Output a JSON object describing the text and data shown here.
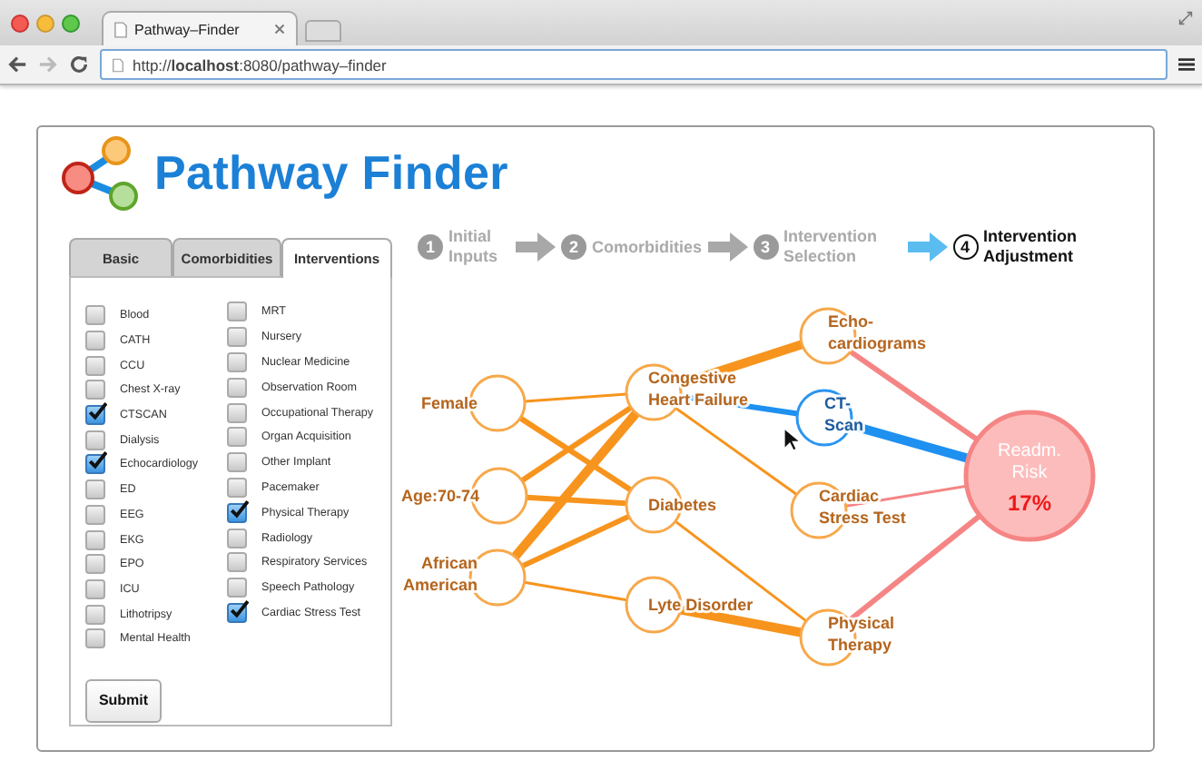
{
  "browser": {
    "tab_title": "Pathway–Finder",
    "url": "http://**localhost**:8080/pathway–finder"
  },
  "app": {
    "title": "Pathway Finder"
  },
  "tabs": [
    {
      "label": "Basic",
      "selected": false
    },
    {
      "label": "Comorbidities",
      "selected": false
    },
    {
      "label": "Interventions",
      "selected": true
    }
  ],
  "interventions": {
    "columns": [
      {
        "items": [
          {
            "label": "Blood",
            "checked": false
          },
          {
            "label": "CATH",
            "checked": false
          },
          {
            "label": "CCU",
            "checked": false
          },
          {
            "label": "Chest X-ray",
            "checked": false
          },
          {
            "label": "CTSCAN",
            "checked": true
          },
          {
            "label": "Dialysis",
            "checked": false
          },
          {
            "label": "Echocardiology",
            "checked": true
          },
          {
            "label": "ED",
            "checked": false
          },
          {
            "label": "EEG",
            "checked": false
          },
          {
            "label": "EKG",
            "checked": false
          },
          {
            "label": "EPO",
            "checked": false
          },
          {
            "label": "ICU",
            "checked": false
          },
          {
            "label": "Lithotripsy",
            "checked": false
          },
          {
            "label": "Mental Health",
            "checked": false
          }
        ]
      },
      {
        "items": [
          {
            "label": "MRT",
            "checked": false
          },
          {
            "label": "Nursery",
            "checked": false
          },
          {
            "label": "Nuclear Medicine",
            "checked": false
          },
          {
            "label": "Observation Room",
            "checked": false
          },
          {
            "label": "Occupational Therapy",
            "checked": false
          },
          {
            "label": "Organ Acquisition",
            "checked": false
          },
          {
            "label": "Other Implant",
            "checked": false
          },
          {
            "label": "Pacemaker",
            "checked": false
          },
          {
            "label": "Physical Therapy",
            "checked": true
          },
          {
            "label": "Radiology",
            "checked": false
          },
          {
            "label": "Respiratory Services",
            "checked": false
          },
          {
            "label": "Speech Pathology",
            "checked": false
          },
          {
            "label": "Cardiac Stress Test",
            "checked": true
          }
        ]
      }
    ]
  },
  "submit": "Submit",
  "steps": [
    {
      "number": "1",
      "label": "Initial Inputs",
      "selected": false
    },
    {
      "number": "2",
      "label": "Comorbidities",
      "selected": false
    },
    {
      "number": "3",
      "label": "Intervention Selection",
      "selected": false
    },
    {
      "number": "4",
      "label": "Intervention Adjustment",
      "selected": true
    }
  ],
  "graph": {
    "factors": [
      {
        "lines": [
          "Female"
        ],
        "selected": false
      },
      {
        "lines": [
          "Age:70-74"
        ],
        "selected": false
      },
      {
        "lines": [
          "African",
          "American"
        ],
        "selected": false
      }
    ],
    "conditions": [
      {
        "lines": [
          "Congestive",
          "Heart Failure"
        ],
        "selected": false
      },
      {
        "lines": [
          "Diabetes"
        ],
        "selected": false
      },
      {
        "lines": [
          "Lyte Disorder"
        ],
        "selected": false
      }
    ],
    "interventions": [
      {
        "lines": [
          "Echo-",
          "cardiograms"
        ],
        "selected": false
      },
      {
        "lines": [
          "CT-",
          "Scan"
        ],
        "selected": true
      },
      {
        "lines": [
          "Cardiac",
          "Stress Test"
        ],
        "selected": false
      },
      {
        "lines": [
          "Physical",
          "Therapy"
        ],
        "selected": false
      }
    ],
    "outcome": {
      "lines": [
        "Readm.",
        "Risk"
      ],
      "value": "17%"
    },
    "edges": [
      {
        "kind": "thin",
        "color": "#f7941d"
      },
      {
        "kind": "medium",
        "color": "#f7941d"
      },
      {
        "kind": "medium",
        "color": "#f7941d"
      },
      {
        "kind": "medium",
        "color": "#f7941d"
      },
      {
        "kind": "thick",
        "color": "#f7941d"
      },
      {
        "kind": "medium",
        "color": "#f7941d"
      },
      {
        "kind": "thin",
        "color": "#f7941d"
      },
      {
        "kind": "thick",
        "color": "#f7941d"
      },
      {
        "kind": "medium",
        "color": "#1e90f0"
      },
      {
        "kind": "thin",
        "color": "#f7941d"
      },
      {
        "kind": "thin",
        "color": "#f7941d"
      },
      {
        "kind": "thick",
        "color": "#f7941d"
      },
      {
        "kind": "medium",
        "color": "#f58585"
      },
      {
        "kind": "thick",
        "color": "#1e90f0"
      },
      {
        "kind": "thin",
        "color": "#f58585"
      },
      {
        "kind": "medium",
        "color": "#f58585"
      }
    ]
  }
}
